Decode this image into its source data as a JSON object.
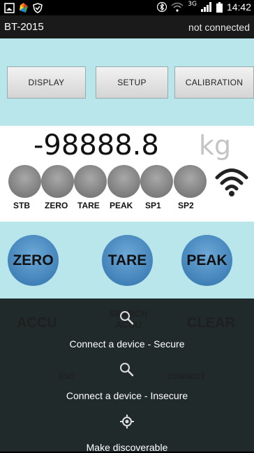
{
  "status_bar": {
    "time": "14:42",
    "network": "3G"
  },
  "title_bar": {
    "app_title": "BT-2015",
    "connection_status": "not connected"
  },
  "menu": {
    "display_label": "DISPLAY",
    "setup_label": "SETUP",
    "calibration_label": "CALIBRATION"
  },
  "readout": {
    "weight": "-98888.8",
    "unit": "kg"
  },
  "indicators": [
    {
      "label": "STB"
    },
    {
      "label": "ZERO"
    },
    {
      "label": "TARE"
    },
    {
      "label": "PEAK"
    },
    {
      "label": "SP1"
    },
    {
      "label": "SP2"
    }
  ],
  "actions": {
    "zero": "ZERO",
    "tare": "TARE",
    "peak": "PEAK",
    "accu": "ACCU",
    "search_accu": "SEARCH ACCU",
    "clear": "CLEAR",
    "esc": "ESC",
    "connect": "CONNECT"
  },
  "overlay_menu": {
    "secure": "Connect a device - Secure",
    "insecure": "Connect a device - Insecure",
    "discoverable": "Make discoverable"
  },
  "colors": {
    "background": "#b9e6ea",
    "button_blue": "#4a8cc4",
    "led_gray": "#8a8a8a"
  }
}
